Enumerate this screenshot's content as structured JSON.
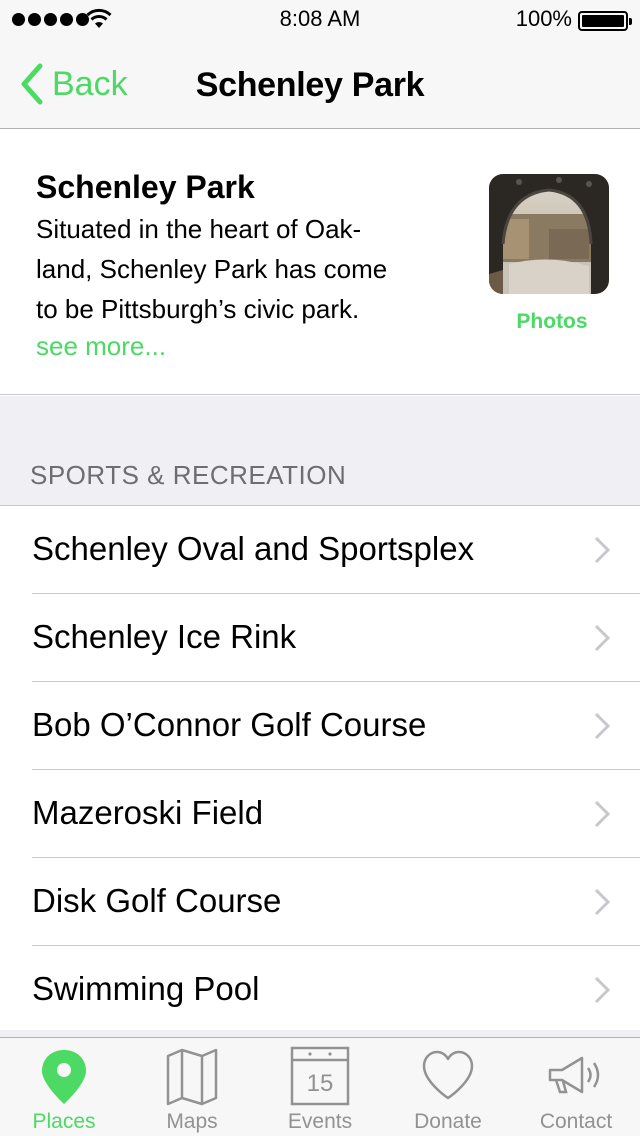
{
  "status_bar": {
    "time": "8:08 AM",
    "battery_percent": "100%",
    "signal_bars": 5,
    "battery_level": 1.0
  },
  "nav": {
    "back_label": "Back",
    "title": "Schenley Park"
  },
  "info": {
    "name": "Schenley Park",
    "description": "Situated in the heart of Oakland, Schenley Park has come to be Pittsburgh’s civic park.",
    "desc_line1": "Situated in the heart of Oak-",
    "desc_line2": "land, Schenley Park has come",
    "desc_line3": "to be Pittsburgh’s civic park.",
    "see_more": "see more...",
    "photos_label": "Photos"
  },
  "section": {
    "header": "SPORTS & RECREATION"
  },
  "items": [
    {
      "label": "Schenley Oval and Sportsplex"
    },
    {
      "label": "Schenley Ice Rink"
    },
    {
      "label": "Bob O’Connor Golf Course"
    },
    {
      "label": "Mazeroski Field"
    },
    {
      "label": "Disk Golf Course"
    },
    {
      "label": "Swimming Pool"
    }
  ],
  "tabs": [
    {
      "label": "Places",
      "icon": "map-pin-icon",
      "active": true
    },
    {
      "label": "Maps",
      "icon": "folded-map-icon",
      "active": false
    },
    {
      "label": "Events",
      "icon": "calendar-icon",
      "active": false,
      "calendar_day": "15"
    },
    {
      "label": "Donate",
      "icon": "heart-icon",
      "active": false
    },
    {
      "label": "Contact",
      "icon": "megaphone-icon",
      "active": false
    }
  ],
  "colors": {
    "accent": "#4cd964",
    "inactive_tab": "#929292",
    "section_background": "#efeff4",
    "bar_background": "#f7f7f7"
  }
}
